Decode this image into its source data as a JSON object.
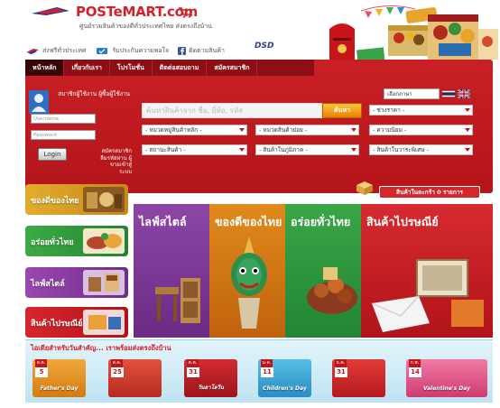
{
  "header": {
    "logo_text": "POSTeMART.com",
    "tagline": "ศูนย์รวมสินค้าของดีทั่วประเทศไทย ส่งตรงถึงบ้าน",
    "quicklinks": [
      {
        "label": "ส่งฟรีทั่วประเทศ",
        "icon": "plane-icon"
      },
      {
        "label": "รับประกันความพอใจ",
        "icon": "shield-icon"
      },
      {
        "label": "ติดตามสินค้า",
        "icon": "facebook-icon"
      }
    ],
    "dsd_logo": "DSD"
  },
  "nav": {
    "tabs": [
      "หน้าหลัก",
      "เกี่ยวกับเรา",
      "โปรโมชั่น",
      "ติดต่อสอบถาม",
      "สมัครสมาชิก"
    ],
    "active_index": 0
  },
  "language": {
    "selected": "เลือกภาษา",
    "flags": [
      "thai-flag",
      "uk-flag"
    ]
  },
  "login": {
    "title": "สมาชิกผู้ใช้งาน ผู้ซื้อผู้ใช้งาน",
    "username_placeholder": "Username",
    "password_placeholder": "Password",
    "login_label": "Login",
    "register_text": "สมัครสมาชิก ลืมรหัสผ่าน ผู้ขายเข้าสู่ระบบ"
  },
  "search": {
    "placeholder": "ค้นหาสินค้าจาก ชื่อ, ยี่ห้อ, รหัส",
    "button_label": "ค้นหา",
    "dropdowns": [
      "- ช่วงราคา -",
      "- หมวดหมู่สินค้าหลัก -",
      "- หมวดสินค้าย่อย -",
      "- ความนิยม -",
      "- สถานะสินค้า -",
      "- สินค้าในภูมิภาค -",
      "- สินค้าในวาระพิเศษ -"
    ]
  },
  "cart": {
    "label": "สินค้าในตะกร้า 0 รายการ"
  },
  "side_buttons": [
    {
      "label": "ของดีของไทย",
      "color": "#d59d1d"
    },
    {
      "label": "อร่อยทั่วไทย",
      "color": "#2f9d3b"
    },
    {
      "label": "ไลฟ์สไตล์",
      "color": "#8c3a9e"
    },
    {
      "label": "สินค้าไปรษณีย์",
      "color": "#cf2027"
    }
  ],
  "panels": [
    {
      "title": "ไลฟ์สไตล์",
      "color": "#7f3a98"
    },
    {
      "title": "ของดีของไทย",
      "color": "#d27a10"
    },
    {
      "title": "อร่อยทั่วไทย",
      "color": "#2f9a3d"
    },
    {
      "title": "สินค้าไปรษณีย์",
      "color": "#cf2027"
    }
  ],
  "promo": {
    "title": "ไอเดียสำหรับวันสำคัญ... เราพร้อมส่งตรงถึงบ้าน",
    "cards": [
      {
        "month": "ส.ค.",
        "day": "5",
        "caption": "Father's Day",
        "color": "#e28a1a"
      },
      {
        "month": "ส.ค.",
        "day": "25",
        "caption": "",
        "color": "#d6403a"
      },
      {
        "month": "ต.ค.",
        "day": "31",
        "caption": "วันฮาโลวีน",
        "color": "#c2202b"
      },
      {
        "month": "ม.ค.",
        "day": "11",
        "caption": "Children's Day",
        "color": "#3aa6d8"
      },
      {
        "month": "ธ.ค.",
        "day": "31",
        "caption": "",
        "color": "#cf2429"
      },
      {
        "month": "ก.พ.",
        "day": "14",
        "caption": "Valentine's Day",
        "color": "#e05a8c"
      }
    ]
  }
}
